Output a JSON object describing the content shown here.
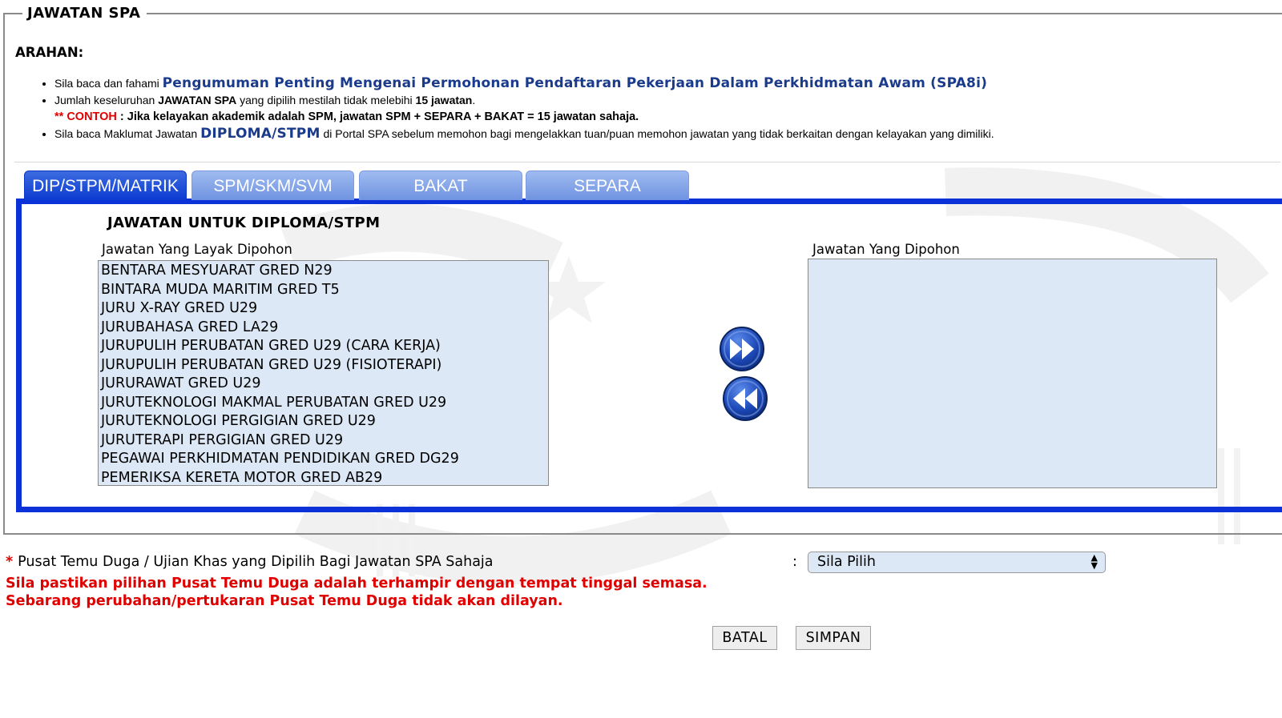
{
  "section_title": "JAWATAN SPA",
  "arahan": {
    "heading": "ARAHAN:",
    "line1_prefix": "Sila baca dan fahami ",
    "line1_link": "Pengumuman Penting Mengenai Permohonan Pendaftaran Pekerjaan Dalam Perkhidmatan Awam (SPA8i)",
    "line2_a": "Jumlah keseluruhan ",
    "line2_b": "JAWATAN SPA",
    "line2_c": " yang dipilih mestilah tidak melebihi ",
    "line2_d": "15 jawatan",
    "line2_e": ".",
    "contoh_prefix": "** CONTOH",
    "contoh_text": " : Jika kelayakan akademik adalah SPM, jawatan SPM + SEPARA + BAKAT = 15 jawatan sahaja.",
    "line3_prefix": "Sila baca Maklumat Jawatan ",
    "line3_link": "DIPLOMA/STPM",
    "line3_suffix": " di Portal SPA sebelum memohon bagi mengelakkan tuan/puan memohon jawatan yang tidak berkaitan dengan kelayakan yang dimiliki."
  },
  "tabs": [
    {
      "label": "DIP/STPM/MATRIK",
      "active": true
    },
    {
      "label": "SPM/SKM/SVM",
      "active": false
    },
    {
      "label": "BAKAT",
      "active": false
    },
    {
      "label": "SEPARA",
      "active": false
    }
  ],
  "panel": {
    "title": "JAWATAN UNTUK DIPLOMA/STPM",
    "available_label": "Jawatan Yang Layak Dipohon",
    "selected_label": "Jawatan Yang Dipohon",
    "available_options": [
      "BENTARA MESYUARAT GRED N29",
      "BINTARA MUDA MARITIM GRED T5",
      "JURU X-RAY GRED U29",
      "JURUBAHASA GRED LA29",
      "JURUPULIH PERUBATAN GRED U29 (CARA KERJA)",
      "JURUPULIH PERUBATAN GRED U29 (FISIOTERAPI)",
      "JURURAWAT GRED U29",
      "JURUTEKNOLOGI MAKMAL PERUBATAN GRED U29",
      "JURUTEKNOLOGI PERGIGIAN GRED U29",
      "JURUTERAPI PERGIGIAN GRED U29",
      "PEGAWAI PERKHIDMATAN PENDIDIKAN GRED DG29",
      "PEMERIKSA KERETA MOTOR GRED AB29"
    ],
    "add_icon": "double-arrow-right-icon",
    "remove_icon": "double-arrow-left-icon"
  },
  "pusat": {
    "required_mark": "*",
    "label": "Pusat Temu Duga / Ujian Khas yang Dipilih Bagi Jawatan SPA Sahaja",
    "colon": ":",
    "select_value": "Sila Pilih",
    "warning_line1": "Sila pastikan pilihan Pusat Temu Duga adalah terhampir dengan tempat tinggal semasa.",
    "warning_line2": "Sebarang perubahan/pertukaran Pusat Temu Duga tidak akan dilayan."
  },
  "buttons": {
    "cancel": "BATAL",
    "save": "SIMPAN"
  },
  "colors": {
    "tab_active": "#0c3bd1",
    "tab_inactive": "#7f9fe6",
    "panel_border": "#0b32d9",
    "listbox_bg": "#dce8f5",
    "link": "#1a3a8c",
    "warning": "#e00000"
  }
}
